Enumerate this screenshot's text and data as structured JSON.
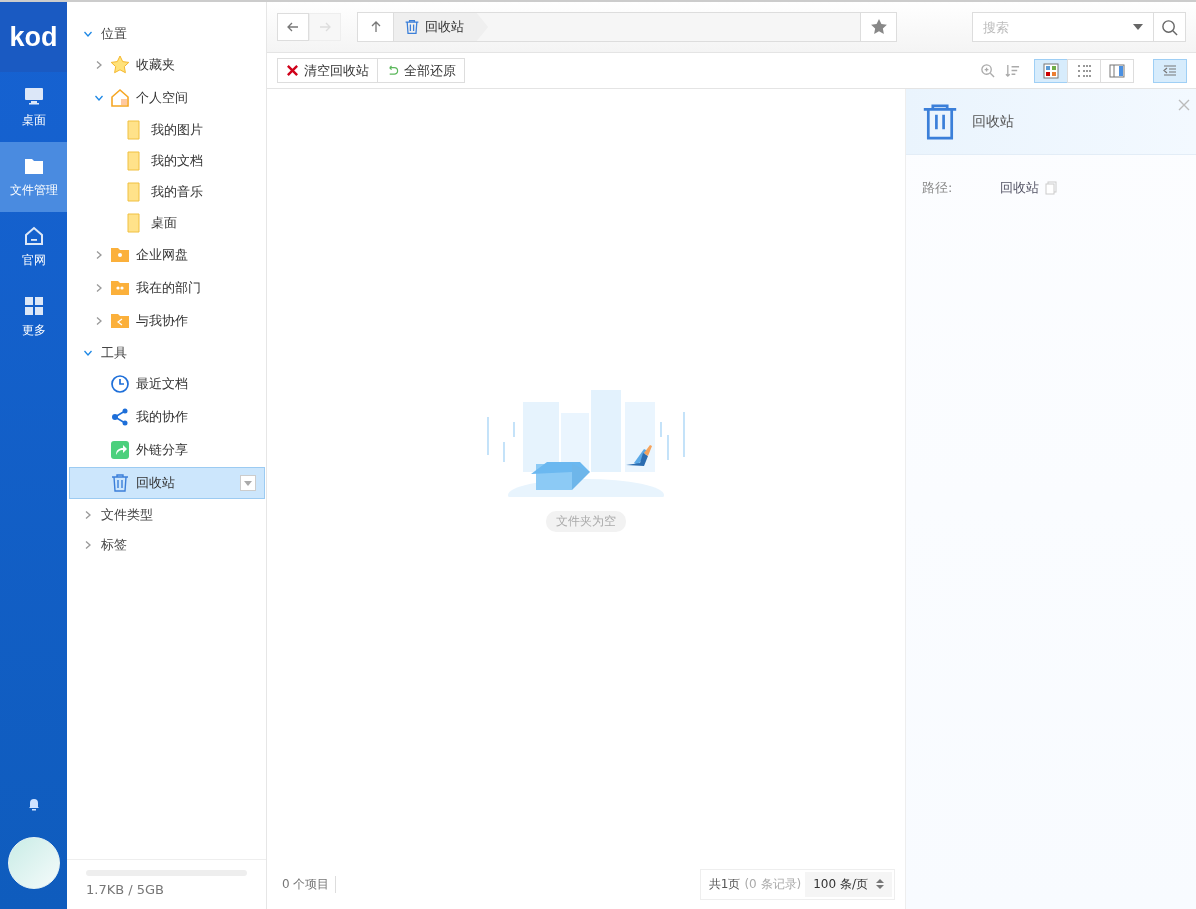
{
  "app_nav": {
    "logo": "kod",
    "items": [
      {
        "label": "桌面",
        "kind": "monitor",
        "selected": false
      },
      {
        "label": "文件管理",
        "kind": "folder",
        "selected": true
      },
      {
        "label": "官网",
        "kind": "home",
        "selected": false
      },
      {
        "label": "更多",
        "kind": "grid",
        "selected": false
      }
    ]
  },
  "tree": {
    "sections": [
      {
        "label": "位置",
        "expanded": true,
        "children": [
          {
            "label": "收藏夹",
            "kind": "star",
            "expanded": false,
            "selected": false
          },
          {
            "label": "个人空间",
            "kind": "house",
            "expanded": true,
            "selected": false,
            "children": [
              {
                "label": "我的图片",
                "kind": "folder",
                "selected": false
              },
              {
                "label": "我的文档",
                "kind": "folder",
                "selected": false
              },
              {
                "label": "我的音乐",
                "kind": "folder",
                "selected": false
              },
              {
                "label": "桌面",
                "kind": "folder",
                "selected": false
              }
            ]
          },
          {
            "label": "企业网盘",
            "kind": "folder-user",
            "expanded": false,
            "selected": false
          },
          {
            "label": "我在的部门",
            "kind": "folder-group",
            "expanded": false,
            "selected": false
          },
          {
            "label": "与我协作",
            "kind": "folder-share",
            "expanded": false,
            "selected": false
          }
        ]
      },
      {
        "label": "工具",
        "expanded": true,
        "children": [
          {
            "label": "最近文档",
            "kind": "clock",
            "selected": false
          },
          {
            "label": "我的协作",
            "kind": "share",
            "selected": false
          },
          {
            "label": "外链分享",
            "kind": "link-share",
            "selected": false
          },
          {
            "label": "回收站",
            "kind": "trash",
            "selected": true
          }
        ]
      },
      {
        "label": "文件类型",
        "expanded": false
      },
      {
        "label": "标签",
        "expanded": false
      }
    ]
  },
  "storage": {
    "usage": "1.7KB / 5GB",
    "level": 0
  },
  "path_bar": {
    "back_disabled": false,
    "forward_disabled": true,
    "crumb": "回收站"
  },
  "search": {
    "placeholder": "搜索"
  },
  "actions": [
    {
      "label": "清空回收站",
      "kind": "clear"
    },
    {
      "label": "全部还原",
      "kind": "restore"
    }
  ],
  "view_modes": [
    {
      "kind": "icons",
      "selected": true
    },
    {
      "kind": "list",
      "selected": false
    },
    {
      "kind": "split",
      "selected": false
    }
  ],
  "info_panel_open": true,
  "empty": {
    "message": "文件夹为空"
  },
  "status_bar": {
    "count": "0 个项目",
    "pages": "共1页",
    "records": "(0 条记录)",
    "page_size": "100 条/页"
  },
  "info_panel": {
    "title": "回收站",
    "fields": [
      {
        "label": "路径:",
        "value": "回收站"
      }
    ]
  }
}
